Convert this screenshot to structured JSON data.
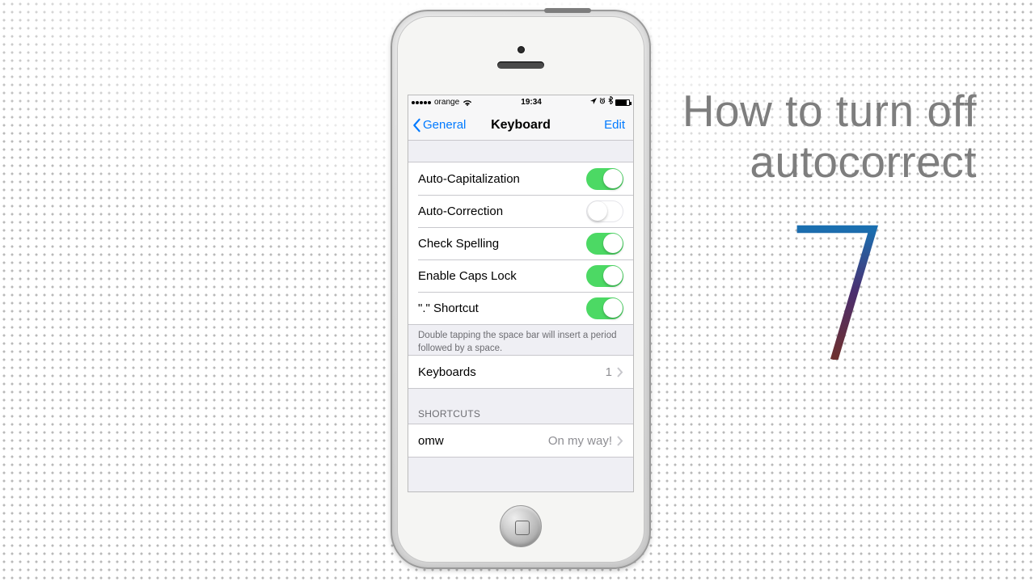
{
  "headline": {
    "line1": "How to turn off",
    "line2": "autocorrect"
  },
  "statusbar": {
    "carrier": "orange",
    "time": "19:34"
  },
  "nav": {
    "back": "General",
    "title": "Keyboard",
    "edit": "Edit"
  },
  "toggles": [
    {
      "label": "Auto-Capitalization",
      "value": true
    },
    {
      "label": "Auto-Correction",
      "value": false
    },
    {
      "label": "Check Spelling",
      "value": true
    },
    {
      "label": "Enable Caps Lock",
      "value": true
    },
    {
      "label": "\".\" Shortcut",
      "value": true
    }
  ],
  "toggles_footer": "Double tapping the space bar will insert a period followed by a space.",
  "keyboards_row": {
    "label": "Keyboards",
    "count": "1"
  },
  "shortcuts_header": "SHORTCUTS",
  "shortcuts": [
    {
      "key": "omw",
      "value": "On my way!"
    }
  ]
}
